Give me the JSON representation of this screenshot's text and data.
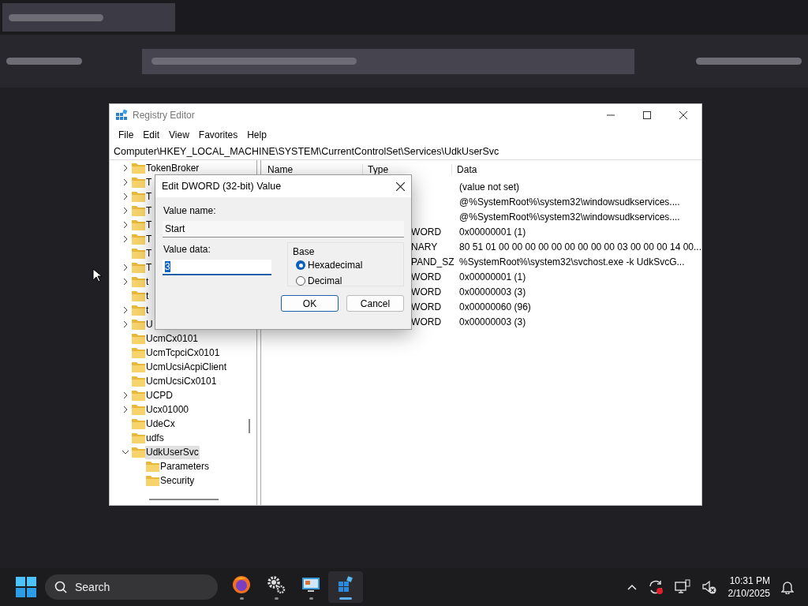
{
  "window": {
    "title": "Registry Editor"
  },
  "menu": [
    "File",
    "Edit",
    "View",
    "Favorites",
    "Help"
  ],
  "address": "Computer\\HKEY_LOCAL_MACHINE\\SYSTEM\\CurrentControlSet\\Services\\UdkUserSvc",
  "tree": [
    {
      "label": "TokenBroker",
      "expandable": true
    },
    {
      "label": "T",
      "expandable": true
    },
    {
      "label": "T",
      "expandable": true
    },
    {
      "label": "T",
      "expandable": true
    },
    {
      "label": "T",
      "expandable": true
    },
    {
      "label": "T",
      "expandable": true
    },
    {
      "label": "T",
      "expandable": false
    },
    {
      "label": "T",
      "expandable": true
    },
    {
      "label": "t",
      "expandable": true
    },
    {
      "label": "t",
      "expandable": false
    },
    {
      "label": "t",
      "expandable": true
    },
    {
      "label": "U",
      "expandable": true
    },
    {
      "label": "UcmCx0101",
      "expandable": false
    },
    {
      "label": "UcmTcpciCx0101",
      "expandable": false
    },
    {
      "label": "UcmUcsiAcpiClient",
      "expandable": false
    },
    {
      "label": "UcmUcsiCx0101",
      "expandable": false
    },
    {
      "label": "UCPD",
      "expandable": true
    },
    {
      "label": "Ucx01000",
      "expandable": true
    },
    {
      "label": "UdeCx",
      "expandable": false
    },
    {
      "label": "udfs",
      "expandable": false
    },
    {
      "label": "UdkUserSvc",
      "expandable": true,
      "expanded": true,
      "selected": true,
      "children": [
        {
          "label": "Parameters",
          "expandable": false
        },
        {
          "label": "Security",
          "expandable": false
        }
      ]
    }
  ],
  "values": {
    "columns": [
      "Name",
      "Type",
      "Data"
    ],
    "rows": [
      {
        "data": "(value not set)"
      },
      {
        "data": "@%SystemRoot%\\system32\\windowsudkservices...."
      },
      {
        "data": "@%SystemRoot%\\system32\\windowsudkservices...."
      },
      {
        "type": "WORD",
        "data": "0x00000001 (1)"
      },
      {
        "type": "NARY",
        "data": "80 51 01 00 00 00 00 00 00 00 00 00 03 00 00 00 14 00..."
      },
      {
        "type": "PAND_SZ",
        "data": "%SystemRoot%\\system32\\svchost.exe -k UdkSvcG..."
      },
      {
        "type": "WORD",
        "data": "0x00000001 (1)"
      },
      {
        "type": "WORD",
        "data": "0x00000003 (3)"
      },
      {
        "type": "WORD",
        "data": "0x00000060 (96)"
      },
      {
        "type": "WORD",
        "data": "0x00000003 (3)"
      }
    ]
  },
  "dialog": {
    "title": "Edit DWORD (32-bit) Value",
    "value_name_label": "Value name:",
    "value_name": "Start",
    "value_data_label": "Value data:",
    "value_data": "3",
    "base_label": "Base",
    "bases": [
      {
        "label": "Hexadecimal",
        "selected": true
      },
      {
        "label": "Decimal",
        "selected": false
      }
    ],
    "buttons": [
      {
        "label": "OK",
        "default": true
      },
      {
        "label": "Cancel",
        "default": false
      }
    ]
  },
  "taskbar": {
    "search_placeholder": "Search",
    "apps": [
      {
        "kind": "firefox",
        "active": false
      },
      {
        "kind": "gears",
        "active": false
      },
      {
        "kind": "monitor",
        "active": false
      },
      {
        "kind": "regedit",
        "active": true
      }
    ],
    "time": "10:31 PM",
    "date": "2/10/2025"
  }
}
